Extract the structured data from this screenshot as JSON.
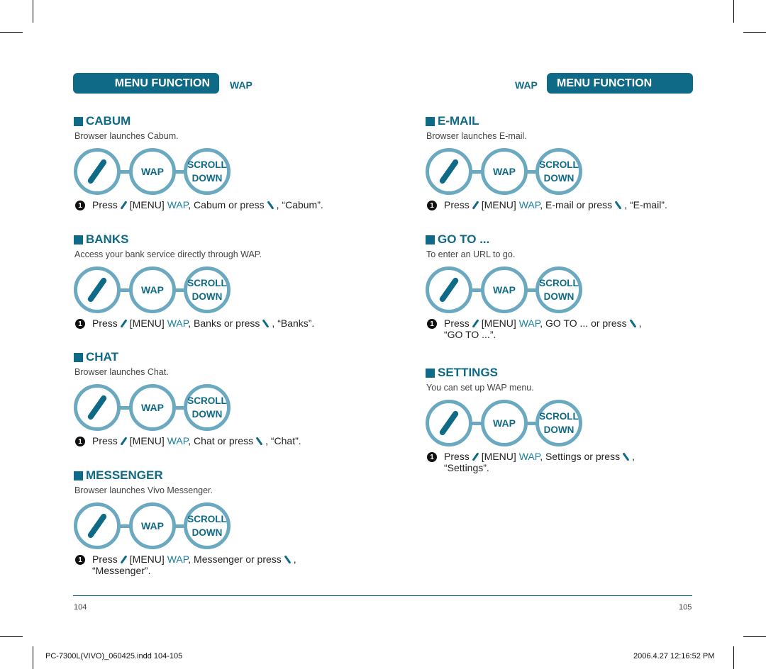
{
  "header": {
    "left": {
      "title": "MENU FUNCTION",
      "subtitle": "WAP"
    },
    "right": {
      "title": "MENU FUNCTION",
      "subtitle": "WAP"
    }
  },
  "keys": {
    "menu_icon": "menu-soft-key-icon",
    "wap": "WAP",
    "scroll_line1": "SCROLL",
    "scroll_line2": "DOWN"
  },
  "sections": [
    {
      "title": "CABUM",
      "desc": "Browser launches Cabum.",
      "num": "1",
      "press": "Press",
      "menu": "[MENU]",
      "wap": "WAP",
      "mid": ", Cabum or press",
      "tail": ",  “Cabum”.",
      "tail2": ""
    },
    {
      "title": "BANKS",
      "desc": "Access your bank service directly through WAP.",
      "num": "1",
      "press": "Press",
      "menu": "[MENU]",
      "wap": "WAP",
      "mid": ", Banks or press",
      "tail": ",  “Banks”.",
      "tail2": ""
    },
    {
      "title": "CHAT",
      "desc": "Browser launches Chat.",
      "num": "1",
      "press": "Press",
      "menu": "[MENU]",
      "wap": "WAP",
      "mid": ", Chat or press",
      "tail": ", “Chat”.",
      "tail2": ""
    },
    {
      "title": "MESSENGER",
      "desc": "Browser launches Vivo Messenger.",
      "num": "1",
      "press": "Press",
      "menu": "[MENU]",
      "wap": "WAP",
      "mid": ", Messenger or press",
      "tail": ",",
      "tail2": "“Messenger”."
    },
    {
      "title": "E-MAIL",
      "desc": "Browser launches E-mail.",
      "num": "1",
      "press": "Press",
      "menu": "[MENU]",
      "wap": "WAP",
      "mid": ", E-mail or press",
      "tail": ",  “E-mail”.",
      "tail2": ""
    },
    {
      "title": "GO TO ...",
      "desc": "To enter an URL to go.",
      "num": "1",
      "press": "Press",
      "menu": "[MENU]",
      "wap": "WAP",
      "mid": ", GO TO ... or press",
      "tail": ",",
      "tail2": "“GO TO ...”."
    },
    {
      "title": "SETTINGS",
      "desc": "You can set up  WAP menu.",
      "num": "1",
      "press": "Press",
      "menu": "[MENU]",
      "wap": "WAP",
      "mid": ", Settings or press",
      "tail": ",",
      "tail2": "“Settings”."
    }
  ],
  "footer": {
    "page_left": "104",
    "page_right": "105",
    "slug_file": "PC-7300L(VIVO)_060425.indd   104-105",
    "slug_date": "2006.4.27   12:16:52 PM"
  },
  "colors": {
    "accent": "#0f6a87",
    "ring": "#6aa9c0"
  }
}
